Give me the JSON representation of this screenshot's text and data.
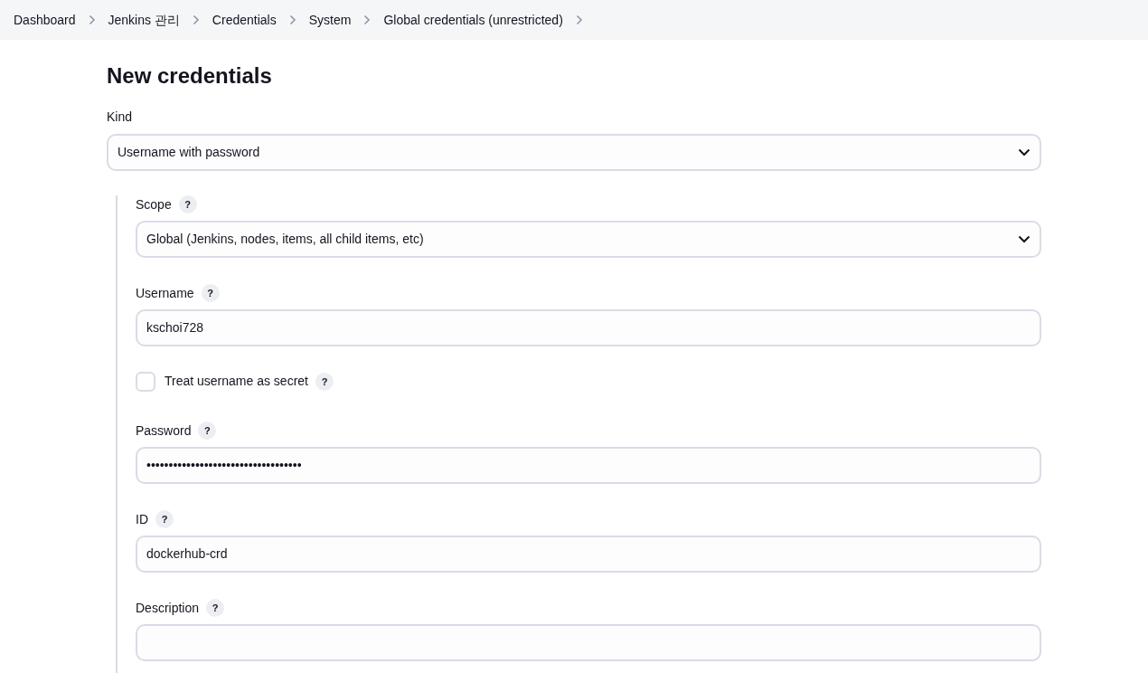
{
  "breadcrumbs": [
    {
      "label": "Dashboard"
    },
    {
      "label": "Jenkins 관리"
    },
    {
      "label": "Credentials"
    },
    {
      "label": "System"
    },
    {
      "label": "Global credentials (unrestricted)"
    }
  ],
  "title": "New credentials",
  "kind_field": {
    "label": "Kind",
    "value": "Username with password"
  },
  "fields": [
    {
      "kind": "select",
      "label": "Scope",
      "help": "?",
      "value": "Global (Jenkins, nodes, items, all child items, etc)"
    },
    {
      "kind": "text",
      "label": "Username",
      "help": "?",
      "value": "kschoi728"
    },
    {
      "kind": "checkbox",
      "label": "Treat username as secret",
      "help": "?",
      "checked": false
    },
    {
      "kind": "password",
      "label": "Password",
      "help": "?",
      "value": "•••••••••••••••••••••••••••••••••••"
    },
    {
      "kind": "text",
      "label": "ID",
      "help": "?",
      "value": "dockerhub-crd"
    },
    {
      "kind": "text",
      "label": "Description",
      "help": "?"
    }
  ]
}
